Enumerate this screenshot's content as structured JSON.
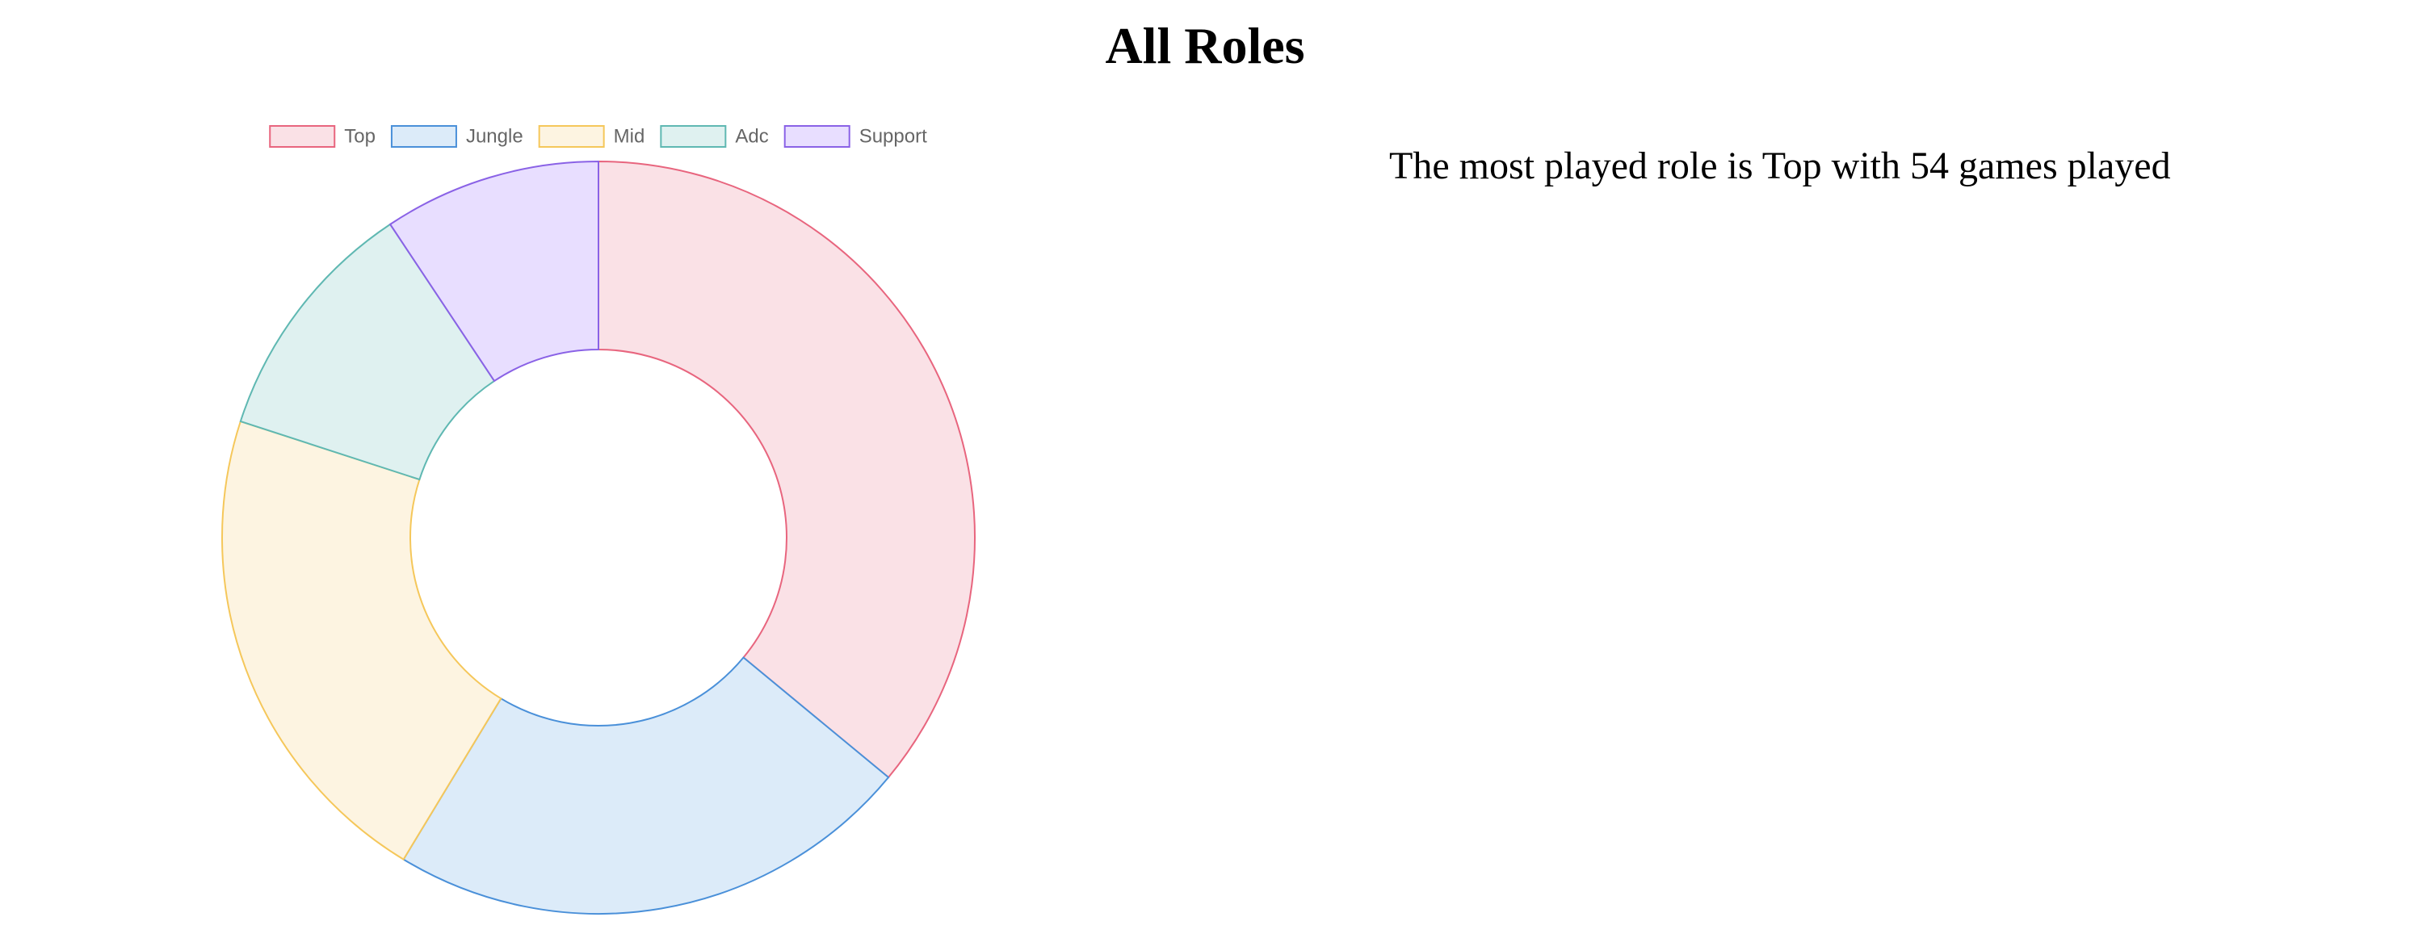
{
  "page": {
    "title": "All Roles",
    "summary": "The most played role is Top with 54 games played"
  },
  "chart_data": {
    "type": "doughnut",
    "title": "",
    "categories": [
      "Top",
      "Jungle",
      "Mid",
      "Adc",
      "Support"
    ],
    "values": [
      54,
      34,
      32,
      16,
      14
    ],
    "legend_position": "top",
    "colors": {
      "borders": [
        "#e8657e",
        "#4a90d9",
        "#f5c75a",
        "#5fb8b2",
        "#8a62e6"
      ],
      "fills": [
        "#fae1e6",
        "#dcebf9",
        "#fdf4e1",
        "#dff1f0",
        "#e8deff"
      ]
    }
  }
}
